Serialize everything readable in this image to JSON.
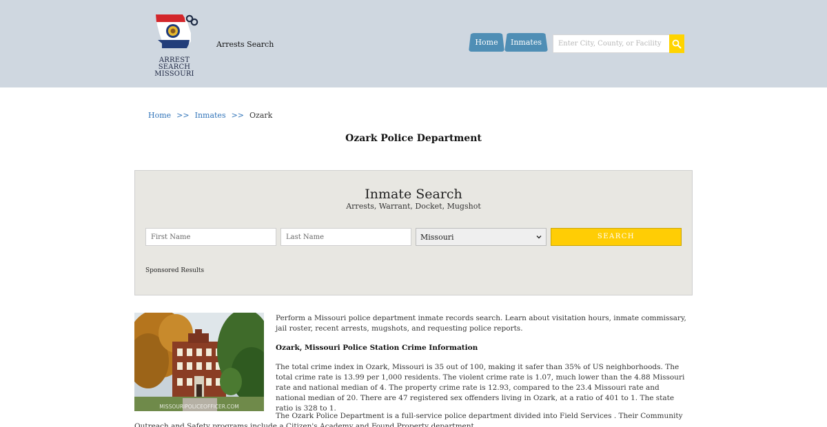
{
  "header": {
    "logo_line1": "ARREST SEARCH",
    "logo_line2": "MISSOURI",
    "site_name": "Arrests Search",
    "nav": {
      "home": "Home",
      "inmates": "Inmates"
    },
    "search_placeholder": "Enter City, County, or Facility",
    "icons": {
      "search": "search-icon",
      "handcuffs": "handcuffs-icon"
    }
  },
  "breadcrumb": {
    "home": "Home",
    "sep": ">>",
    "inmates": "Inmates",
    "current": "Ozark"
  },
  "page_title": "Ozark Police Department",
  "search_panel": {
    "title": "Inmate Search",
    "subtitle": "Arrests, Warrant, Docket, Mugshot",
    "first_placeholder": "First Name",
    "last_placeholder": "Last Name",
    "state_selected": "Missouri",
    "button": "SEARCH",
    "sponsored": "Sponsored Results"
  },
  "photo": {
    "watermark": "MISSOURIPOLICEOFFICER.COM"
  },
  "content": {
    "intro": "Perform a Missouri police department inmate records search. Learn about visitation hours, inmate commissary, jail roster, recent arrests, mugshots, and requesting police reports.",
    "crime_heading": "Ozark, Missouri Police Station Crime Information",
    "crime_text": "The total crime index in Ozark, Missouri is 35 out of 100, making it safer than 35% of US neighborhoods. The total crime rate is 13.99 per 1,000 residents. The violent crime rate is 1.07, much lower than the 4.88 Missouri rate and national median of 4. The property crime rate is 12.93, compared to the 23.4 Missouri rate and national median of 20. There are 47 registered sex offenders living in Ozark, at a ratio of 401 to 1. The state ratio is 328 to 1.",
    "dept_text": "The Ozark Police Department is a full-service police department divided into Field Services . Their Community Outreach and Safety programs include a Citizen's Academy and Found Property department."
  },
  "colors": {
    "header_bg": "#cfd7e0",
    "nav_bg": "#4f8eb5",
    "accent_yellow": "#ffcd05",
    "link_blue": "#2e72b8",
    "panel_bg": "#e8e7e2"
  }
}
